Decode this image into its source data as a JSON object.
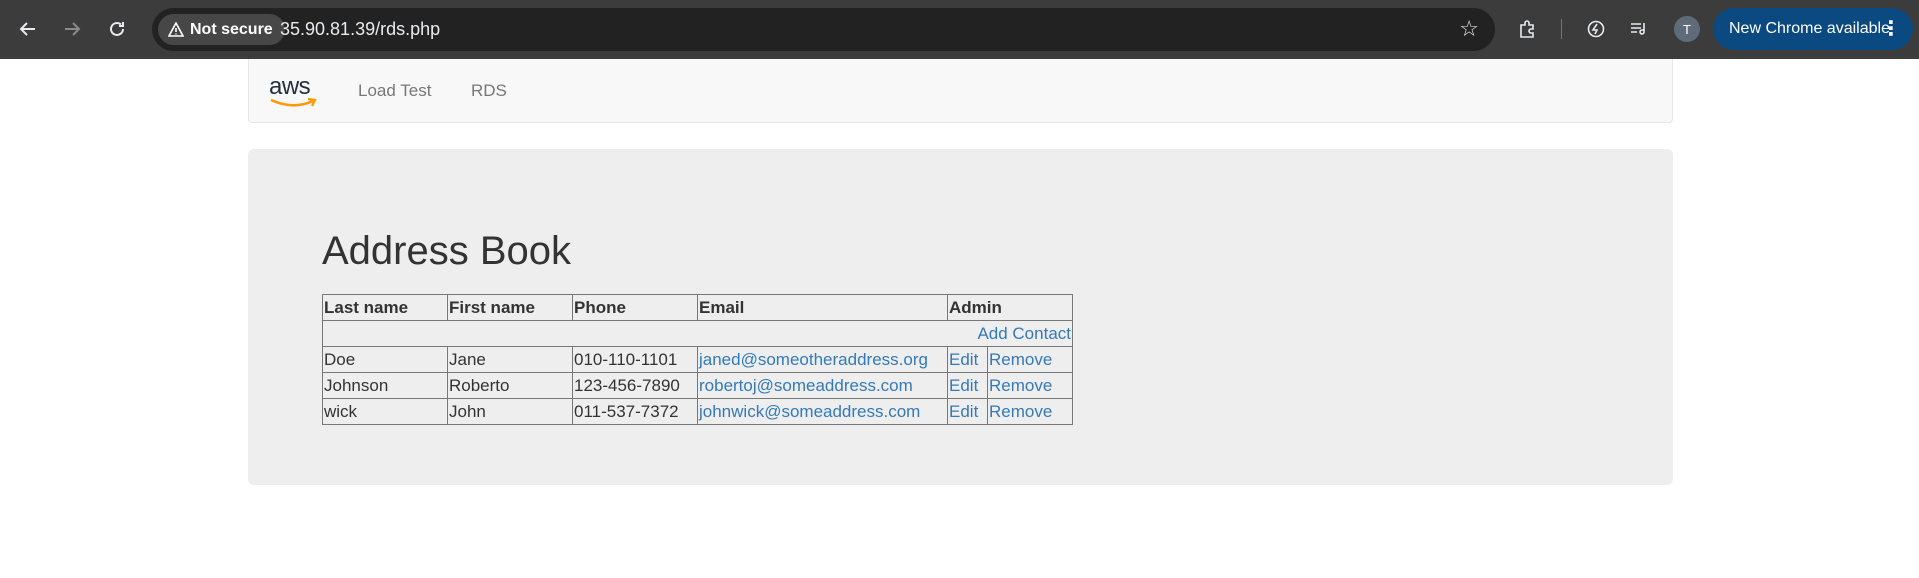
{
  "browser": {
    "security_label": "Not secure",
    "url": "35.90.81.39/rds.php",
    "avatar_initial": "T",
    "update_label": "New Chrome available"
  },
  "navbar": {
    "logo_text": "aws",
    "links": [
      {
        "label": "Load Test"
      },
      {
        "label": "RDS"
      }
    ]
  },
  "main": {
    "title": "Address Book",
    "columns": [
      "Last name",
      "First name",
      "Phone",
      "Email",
      "Admin"
    ],
    "add_contact_label": "Add Contact",
    "rows": [
      {
        "last": "Doe",
        "first": "Jane",
        "phone": "010-110-1101",
        "email": "janed@someotheraddress.org",
        "edit": "Edit",
        "remove": "Remove"
      },
      {
        "last": "Johnson",
        "first": "Roberto",
        "phone": "123-456-7890",
        "email": "robertoj@someaddress.com",
        "edit": "Edit",
        "remove": "Remove"
      },
      {
        "last": "wick",
        "first": "John",
        "phone": "011-537-7372",
        "email": "johnwick@someaddress.com",
        "edit": "Edit",
        "remove": "Remove"
      }
    ]
  },
  "colors": {
    "link": "#337ab7",
    "jumbotron_bg": "#eeeeee",
    "chrome_bar": "#3c3c3c",
    "update_pill": "#0b4a80"
  }
}
